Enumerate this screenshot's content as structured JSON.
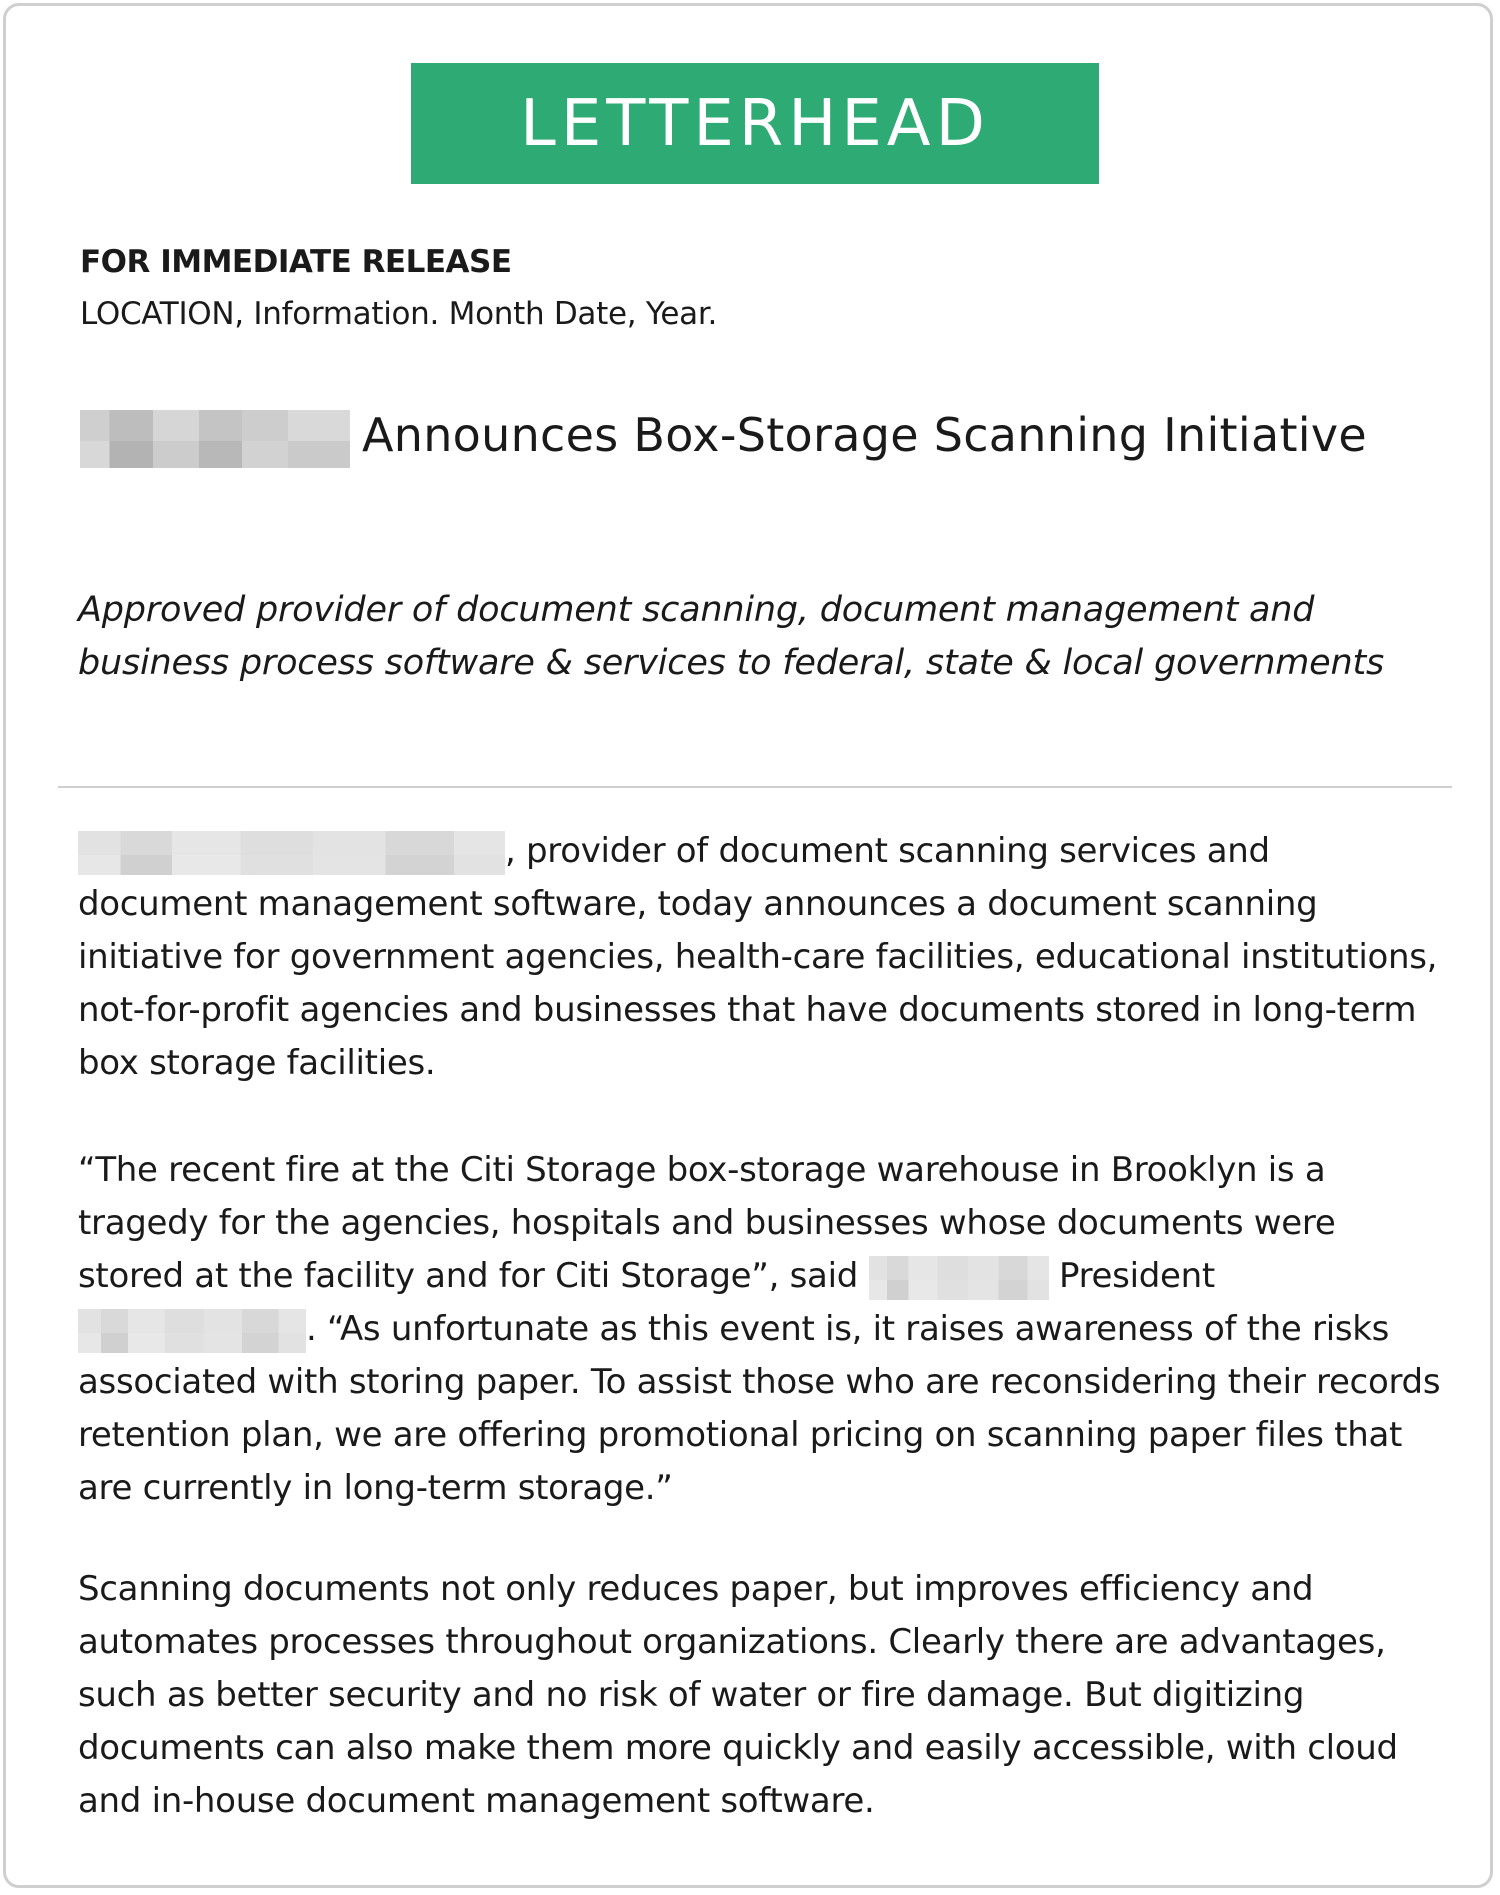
{
  "letterhead": {
    "label": "LETTERHEAD",
    "color": "#2eab74"
  },
  "release": {
    "label": "FOR IMMEDIATE RELEASE",
    "location_line": "LOCATION, Information. Month Date, Year."
  },
  "headline": {
    "text": "Announces Box-Storage Scanning Initiative"
  },
  "subhead": {
    "text": "Approved provider of document scanning, document management and business process software & services to federal, state & local governments"
  },
  "paragraphs": {
    "p1_text": ", provider of document scanning services and document management software, today announces a document scanning initiative for government agencies, health-care facilities, educational institutions, not-for-profit agencies and businesses that have documents stored in long-term box storage facilities.",
    "p2_part1": "“The recent fire at the Citi Storage box-storage warehouse in Brooklyn is a tragedy for the agencies, hospitals and businesses whose documents were stored at the facility and for Citi Storage”, said ",
    "p2_part2": " President ",
    "p2_part3": ".  “As unfortunate as this event is, it raises awareness of the risks associated with storing paper. To assist those who are reconsidering their records retention plan, we are offering promotional pricing on scanning paper files that are currently in long-term storage.”",
    "p3_text": "Scanning documents not only reduces paper, but improves efficiency and automates processes throughout organizations. Clearly there are advantages, such as better security and no risk of water or fire damage. But digitizing documents can also make them more quickly and easily accessible, with cloud and in-house document management software."
  }
}
